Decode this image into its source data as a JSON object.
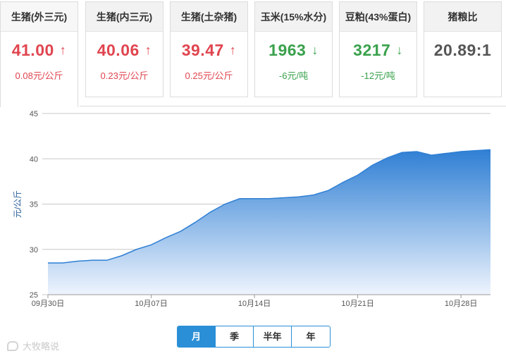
{
  "cards": [
    {
      "title": "生猪(外三元)",
      "price": "41.00",
      "arrow": "↑",
      "trend": "up",
      "change": "0.08元/公斤"
    },
    {
      "title": "生猪(内三元)",
      "price": "40.06",
      "arrow": "↑",
      "trend": "up",
      "change": "0.23元/公斤"
    },
    {
      "title": "生猪(土杂猪)",
      "price": "39.47",
      "arrow": "↑",
      "trend": "up",
      "change": "0.25元/公斤"
    },
    {
      "title": "玉米(15%水分)",
      "price": "1963",
      "arrow": "↓",
      "trend": "down",
      "change": "-6元/吨"
    },
    {
      "title": "豆粕(43%蛋白)",
      "price": "3217",
      "arrow": "↓",
      "trend": "down",
      "change": "-12元/吨"
    },
    {
      "title": "猪粮比",
      "price": "20.89:1",
      "arrow": "",
      "trend": "flat",
      "change": ""
    }
  ],
  "chart_data": {
    "type": "area",
    "ylabel": "元/公斤",
    "ylim": [
      25,
      45
    ],
    "yticks": [
      25,
      30,
      35,
      40,
      45
    ],
    "xtick_labels": [
      "09月30日",
      "10月07日",
      "10月14日",
      "10月21日",
      "10月28日"
    ],
    "xtick_days": [
      0,
      7,
      14,
      21,
      28
    ],
    "x_days": [
      0,
      1,
      2,
      3,
      4,
      5,
      6,
      7,
      8,
      9,
      10,
      11,
      12,
      13,
      14,
      15,
      16,
      17,
      18,
      19,
      20,
      21,
      22,
      23,
      24,
      25,
      26,
      27,
      28,
      29,
      30
    ],
    "values": [
      28.5,
      28.5,
      28.7,
      28.8,
      28.8,
      29.3,
      30.0,
      30.5,
      31.3,
      32.0,
      33.0,
      34.1,
      35.0,
      35.6,
      35.6,
      35.6,
      35.7,
      35.8,
      36.0,
      36.5,
      37.4,
      38.2,
      39.3,
      40.1,
      40.7,
      40.8,
      40.4,
      40.6,
      40.8,
      40.9,
      41.0
    ],
    "colors": {
      "line": "#2f7fd4",
      "fill_top": "#2f7fd4",
      "fill_bottom": "#eef4fd",
      "grid": "#c8c8c8",
      "axis_text": "#555555",
      "ylabel": "#2b5f9a"
    },
    "grid": true
  },
  "range_tabs": [
    {
      "label": "月",
      "active": true
    },
    {
      "label": "季",
      "active": false
    },
    {
      "label": "半年",
      "active": false
    },
    {
      "label": "年",
      "active": false
    }
  ],
  "watermark": "大牧略说"
}
